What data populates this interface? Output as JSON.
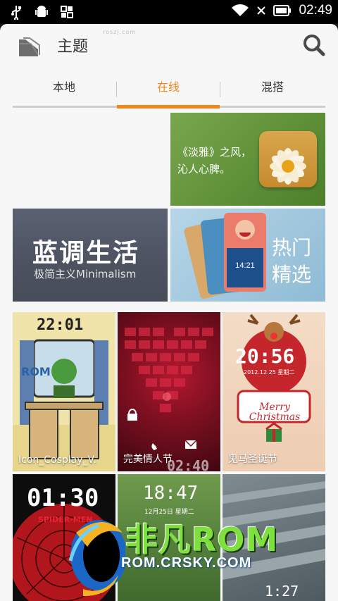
{
  "status_bar": {
    "time": "02:49",
    "icons": [
      "usb-icon",
      "android-debug-icon",
      "apps-grid-icon",
      "wifi-icon",
      "no-signal-icon",
      "battery-icon"
    ]
  },
  "header": {
    "title": "主题",
    "watermark": "roszj.com",
    "icons": [
      "theme-folder-icon",
      "search-icon"
    ]
  },
  "tabs": [
    {
      "label": "本地",
      "active": false
    },
    {
      "label": "在线",
      "active": true
    },
    {
      "label": "混搭",
      "active": false
    }
  ],
  "accent_color": "#f08519",
  "banners": [
    {
      "line1": "《淡雅》之风，",
      "line2": "沁人心脾。"
    },
    {
      "title": "蓝调生活",
      "subtitle": "极简主义Minimalism"
    },
    {
      "line1": "热门",
      "line2": "精选"
    }
  ],
  "themes": [
    {
      "label": "Icon_Cosplay_V.",
      "clock": "22:01"
    },
    {
      "label": "完美情人节",
      "clock": "02:40"
    },
    {
      "label": "鬼马圣诞节",
      "clock": "20:56",
      "date": "2012.12.25  星期二",
      "script": "Merry Christmas"
    },
    {
      "label": "",
      "clock": "01:30",
      "tag": "SPIDER-MEN"
    },
    {
      "label": "",
      "clock": "18:47",
      "date": "12月25日 星期二"
    },
    {
      "label": "",
      "clock": "1:27"
    }
  ],
  "watermark_logo": {
    "title": "非凡ROM",
    "url": "ROM.CRSKY.COM"
  }
}
